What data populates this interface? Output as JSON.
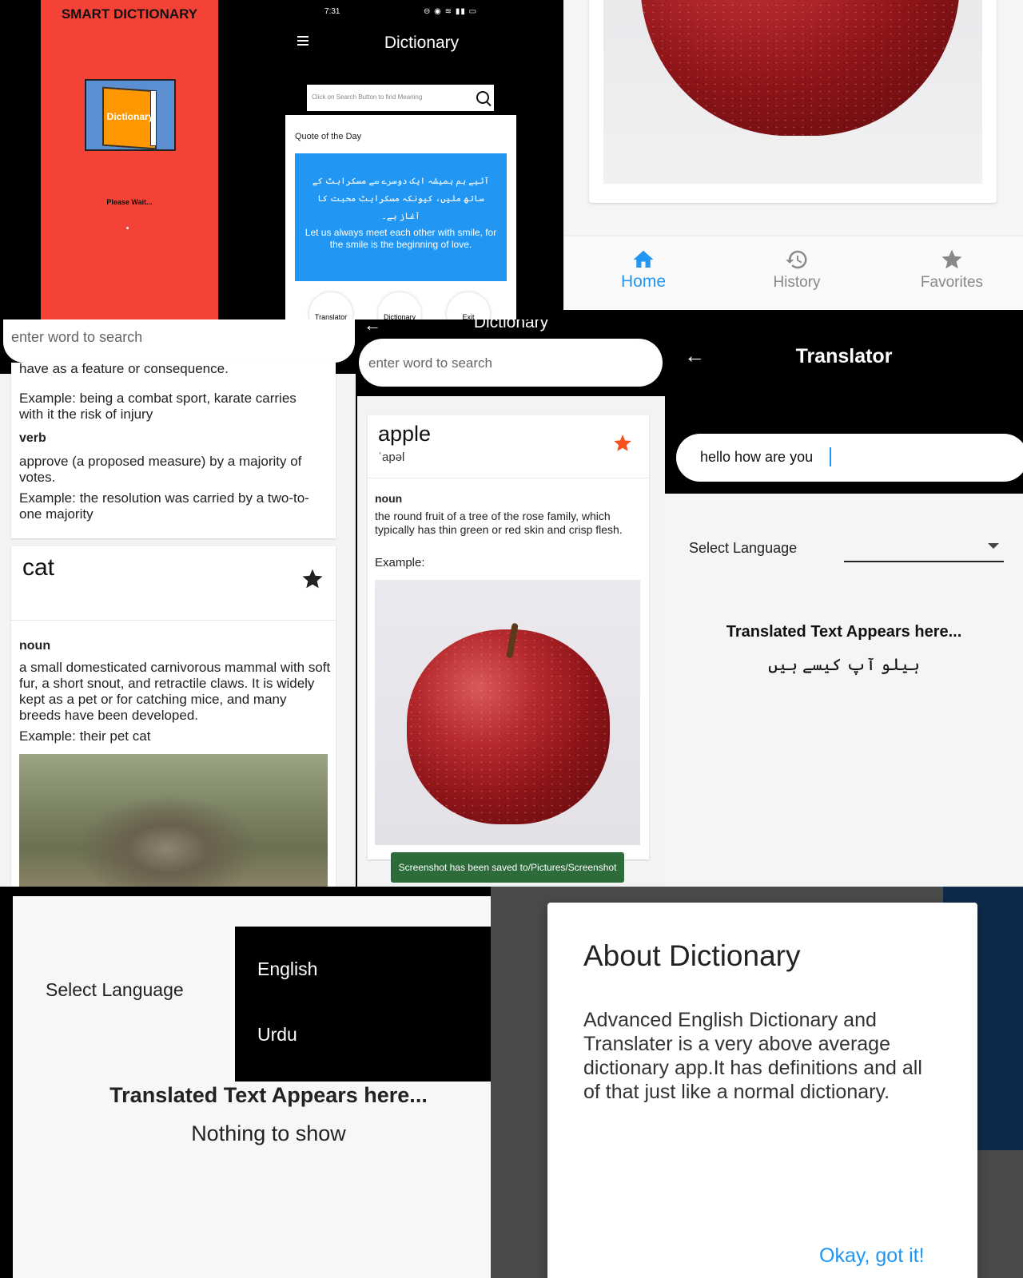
{
  "splash": {
    "title": "SMART DICTIONARY",
    "book_label": "Dictionary",
    "wait_text": "Please Wait..."
  },
  "home_phone": {
    "status_time": "7:31",
    "app_title": "Dictionary",
    "search_placeholder": "Click on Search Button to find Meaning",
    "quote_header": "Quote of the Day",
    "quote_urdu": "آئیے ہم ہمیشہ ایک دوسرے سے مسکراہٹ کے ساتھ ملیں، کیونکہ مسکراہٹ محبت کا آغاز ہے۔",
    "quote_english": "Let us always meet each other with smile, for the smile is the beginning of love.",
    "buttons": [
      "Translator",
      "Dictionary",
      "Exit"
    ]
  },
  "bottom_nav": {
    "items": [
      {
        "label": "Home",
        "icon": "home-icon"
      },
      {
        "label": "History",
        "icon": "history-icon"
      },
      {
        "label": "Favorites",
        "icon": "star-icon"
      }
    ]
  },
  "cat_screen": {
    "search_placeholder": "enter word to search",
    "partial_line": "have as a feature or consequence.",
    "example1": "Example: being a combat sport, karate carries with it the risk of injury",
    "pos_verb": "verb",
    "verb_def": "approve (a proposed measure) by a majority of votes.",
    "verb_example": "Example: the resolution was carried by a two-to-one majority",
    "word": "cat",
    "pos_noun": "noun",
    "noun_def": "a small domesticated carnivorous mammal with soft fur, a short snout, and retractile claws. It is widely kept as a pet or for catching mice, and many breeds have been developed.",
    "noun_example": "Example: their pet cat"
  },
  "apple_screen": {
    "title": "Dictionary",
    "search_placeholder": "enter word to search",
    "word": "apple",
    "phonetic": "ˈapəl",
    "pos": "noun",
    "definition": "the round fruit of a tree of the rose family, which typically has thin green or red skin and crisp flesh.",
    "example_label": "Example:",
    "toast": "Screenshot has been saved to/Pictures/Screenshot",
    "favorite_color": "#f4511e"
  },
  "translator": {
    "title": "Translator",
    "input_value": "hello how are you",
    "select_label": "Select Language",
    "result_header": "Translated Text Appears here...",
    "result_text": "ہیلو آپ کیسے ہیں"
  },
  "lang_menu": {
    "select_label": "Select Language",
    "options": [
      "English",
      "Urdu"
    ],
    "result_header": "Translated Text Appears here...",
    "result_text": "Nothing to show"
  },
  "about": {
    "title": "About Dictionary",
    "body": "Advanced English Dictionary and Translater is a very above average dictionary app.It has definitions and all of that just like a normal dictionary.",
    "ok_label": "Okay, got it!"
  },
  "colors": {
    "splash_red": "#f44336",
    "accent_blue": "#2196f3",
    "book_orange": "#ff9800"
  }
}
